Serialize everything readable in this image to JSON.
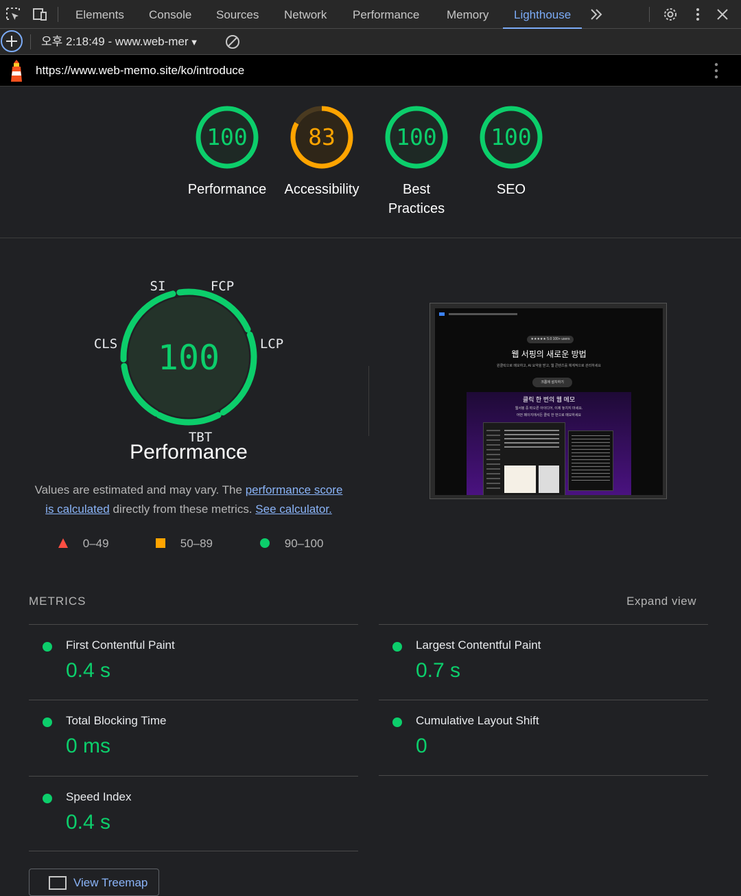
{
  "devtools": {
    "tabs": [
      "Elements",
      "Console",
      "Sources",
      "Network",
      "Performance",
      "Memory",
      "Lighthouse"
    ],
    "active_tab": "Lighthouse",
    "accent": "#7cacf8"
  },
  "report": {
    "selected": "오후 2:18:49 - www.web-mer",
    "url": "https://www.web-memo.site/ko/introduce"
  },
  "scores": [
    {
      "label": "Performance",
      "value": "100",
      "color": "#0cce6b"
    },
    {
      "label": "Accessibility",
      "value": "83",
      "color": "#ffa400"
    },
    {
      "label": "Best Practices",
      "label_lines": [
        "Best",
        "Practices"
      ],
      "value": "100",
      "color": "#0cce6b"
    },
    {
      "label": "SEO",
      "value": "100",
      "color": "#0cce6b"
    }
  ],
  "performance": {
    "score": "100",
    "title": "Performance",
    "segments": [
      "SI",
      "FCP",
      "LCP",
      "TBT",
      "CLS"
    ],
    "desc_prefix": "Values are estimated and may vary. The ",
    "link_score": "performance score",
    "link_score_2": "is calculated",
    "desc_mid": " directly from these metrics. ",
    "link_calc": "See calculator.",
    "legend": [
      {
        "range": "0–49",
        "color": "#ff4e42"
      },
      {
        "range": "50–89",
        "color": "#ffa400"
      },
      {
        "range": "90–100",
        "color": "#0cce6b"
      }
    ]
  },
  "thumbnail": {
    "badge": "★★★★★ 5.0  100+ users",
    "headline": "웹 서핑의 새로운 방법",
    "sub": "원클릭으로 메모하고, AI 요약을 받고, 웹 콘텐츠를 체계적으로 관리하세요",
    "cta": "크롬에 설치하기",
    "section_title": "클릭 한 번의 웹 메모",
    "section_sub1": "웹서핑 중 떠오른 아이디어, 이제 놓치지 마세요.",
    "section_sub2": "어떤 페이지에서든 클릭 한 번으로 메모하세요"
  },
  "metrics": {
    "heading": "METRICS",
    "expand": "Expand view",
    "items": [
      {
        "name": "First Contentful Paint",
        "value": "0.4 s"
      },
      {
        "name": "Largest Contentful Paint",
        "value": "0.7 s"
      },
      {
        "name": "Total Blocking Time",
        "value": "0 ms"
      },
      {
        "name": "Cumulative Layout Shift",
        "value": "0"
      },
      {
        "name": "Speed Index",
        "value": "0.4 s"
      }
    ],
    "treemap": "View Treemap"
  }
}
